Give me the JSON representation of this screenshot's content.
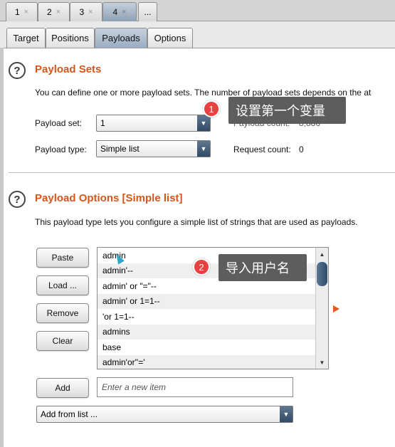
{
  "top_tabs": [
    {
      "label": "1",
      "close": "×"
    },
    {
      "label": "2",
      "close": "×"
    },
    {
      "label": "3",
      "close": "×"
    },
    {
      "label": "4",
      "close": "×",
      "active": true
    },
    {
      "label": "..."
    }
  ],
  "sub_tabs": [
    "Target",
    "Positions",
    "Payloads",
    "Options"
  ],
  "payload_sets": {
    "title": "Payload Sets",
    "description": "You can define one or more payload sets. The number of payload sets depends on the at",
    "payload_set_label": "Payload set:",
    "payload_set_value": "1",
    "payload_count_label": "Payload count:",
    "payload_count_value": "8,886",
    "payload_type_label": "Payload type:",
    "payload_type_value": "Simple list",
    "request_count_label": "Request count:",
    "request_count_value": "0"
  },
  "payload_options": {
    "title": "Payload Options [Simple list]",
    "description": "This payload type lets you configure a simple list of strings that are used as payloads.",
    "buttons": {
      "paste": "Paste",
      "load": "Load ...",
      "remove": "Remove",
      "clear": "Clear",
      "add": "Add"
    },
    "items": [
      "admin",
      "admin'--",
      "admin' or \"=\"--",
      "admin' or 1=1--",
      "'or 1=1--",
      "admins",
      "base",
      "admin'or''='"
    ],
    "add_placeholder": "Enter a new item",
    "add_from_list": "Add from list ..."
  },
  "annotations": {
    "callout1": {
      "number": "1",
      "text": "设置第一个变量"
    },
    "callout2": {
      "number": "2",
      "text": "导入用户名"
    }
  },
  "colors": {
    "section_title": "#d3561b",
    "callout_bg": "#5d5d5d",
    "badge": "#e84140",
    "active_tab": "#9aadc2"
  },
  "icons": {
    "help": "question-circle-icon",
    "dropdown": "triangle-down-icon"
  }
}
